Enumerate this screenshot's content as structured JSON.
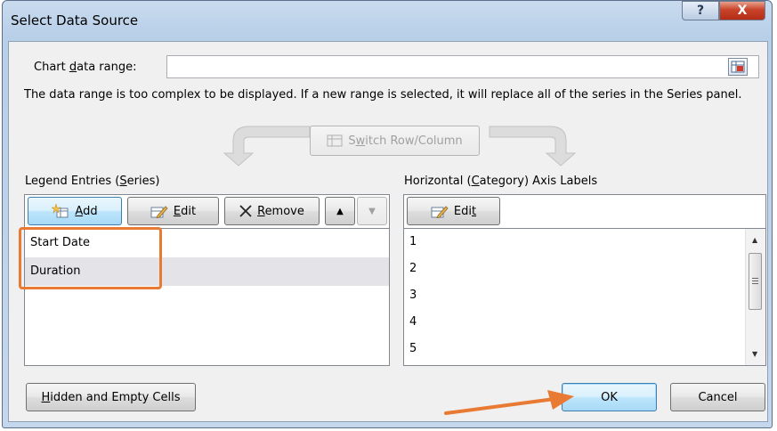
{
  "window": {
    "title": "Select Data Source",
    "help_label": "?",
    "close_label": "X"
  },
  "chart_range": {
    "label_pre": "Chart ",
    "label_u": "d",
    "label_post": "ata range:",
    "value": "",
    "message": "The data range is too complex to be displayed. If a new range is selected, it will replace all of the series in the Series panel."
  },
  "switch": {
    "pre": "S",
    "u": "w",
    "post": "itch Row/Column"
  },
  "legend": {
    "title_pre": "Legend Entries (",
    "title_u": "S",
    "title_post": "eries)",
    "add": {
      "u": "A",
      "post": "dd"
    },
    "edit": {
      "u": "E",
      "post": "dit"
    },
    "remove": {
      "u": "R",
      "post": "emove"
    },
    "up_label": "▲",
    "down_label": "▼",
    "items": [
      "Start Date",
      "Duration"
    ]
  },
  "axis": {
    "title_pre": "Horizontal (",
    "title_u": "C",
    "title_post": "ategory) Axis Labels",
    "edit": {
      "pre": "Edi",
      "u": "t",
      "post": ""
    },
    "items": [
      "1",
      "2",
      "3",
      "4",
      "5"
    ]
  },
  "footer": {
    "hidden_u": "H",
    "hidden_post": "idden and Empty Cells",
    "ok": "OK",
    "cancel": "Cancel"
  },
  "colors": {
    "highlight": "#e87a33",
    "arrow": "#e87a33",
    "accent": "#3c7fb1"
  }
}
